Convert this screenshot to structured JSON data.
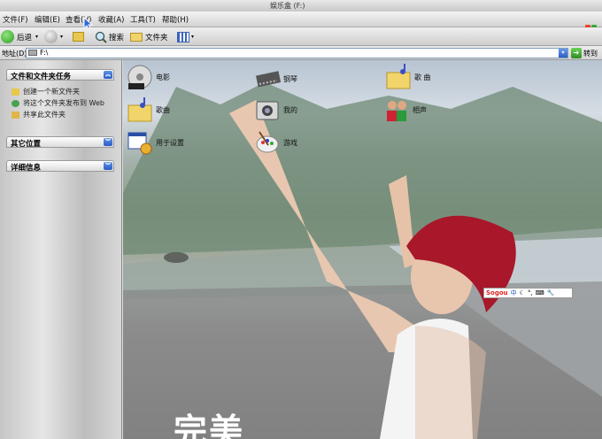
{
  "window": {
    "title": "娱乐盒 (F:)"
  },
  "menu": [
    "文件(F)",
    "编辑(E)",
    "查看(V)",
    "收藏(A)",
    "工具(T)",
    "帮助(H)"
  ],
  "toolbar": {
    "back": "后退",
    "search": "搜索",
    "folders": "文件夹"
  },
  "address": {
    "label": "地址(D)",
    "value": "F:\\",
    "go": "转到"
  },
  "sidebar": {
    "tasks": {
      "title": "文件和文件夹任务",
      "items": [
        "创建一个新文件夹",
        "将这个文件夹发布到 Web",
        "共享此文件夹"
      ]
    },
    "other": {
      "title": "其它位置"
    },
    "details": {
      "title": "详细信息"
    }
  },
  "files": [
    "电影",
    "钢琴",
    "歌 曲",
    "歌曲",
    "我的",
    "相声",
    "用于设置",
    "游戏"
  ],
  "wallpaper": {
    "text": "完美"
  },
  "ime": {
    "brand": "Sogou",
    "mode": "中"
  },
  "colors": {
    "accent": "#2c5cc5",
    "go": "#3a9a2a",
    "sidebar": "#d0d0d0"
  }
}
